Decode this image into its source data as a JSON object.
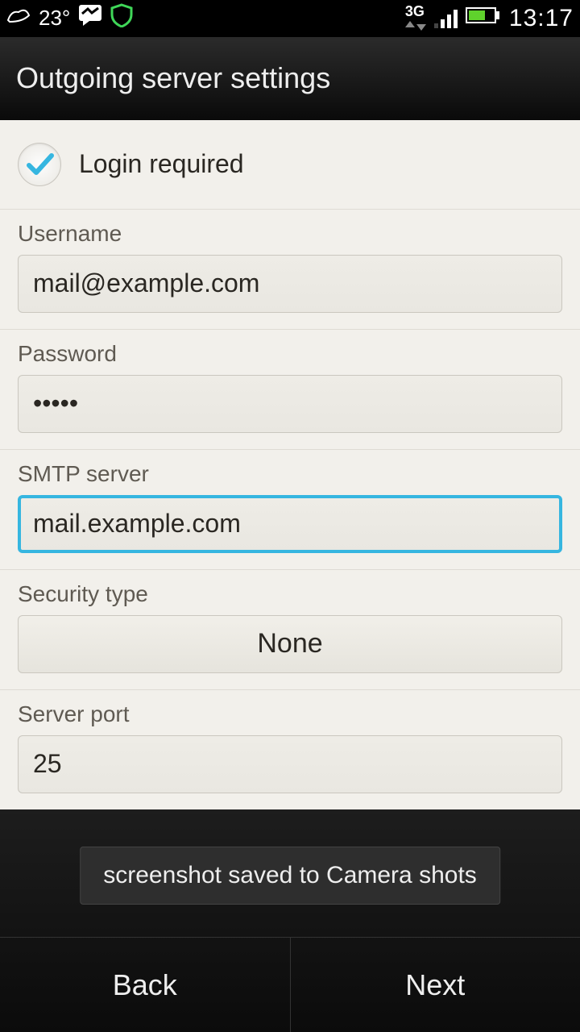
{
  "status_bar": {
    "temperature": "23°",
    "network_label": "3G",
    "time": "13:17"
  },
  "title": "Outgoing server settings",
  "login_required": {
    "label": "Login required",
    "checked": true
  },
  "fields": {
    "username_label": "Username",
    "username_value": "mail@example.com",
    "password_label": "Password",
    "password_value": "•••••",
    "smtp_label": "SMTP server",
    "smtp_value": "mail.example.com",
    "security_label": "Security type",
    "security_value": "None",
    "port_label": "Server port",
    "port_value": "25"
  },
  "toast": "screenshot saved to Camera shots",
  "buttons": {
    "back": "Back",
    "next": "Next"
  }
}
